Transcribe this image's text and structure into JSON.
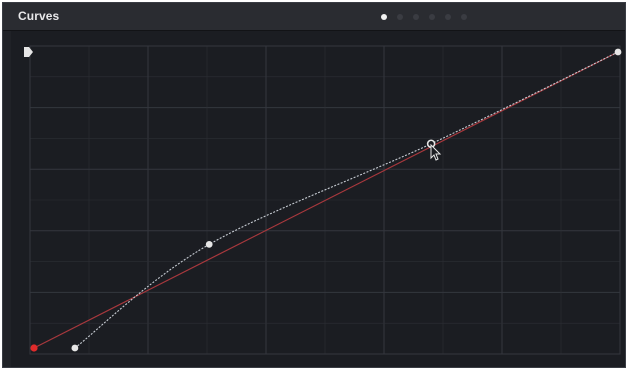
{
  "panel": {
    "title": "Curves",
    "pager": {
      "page_count": 6,
      "active_index": 0
    }
  },
  "curve": {
    "control_points": [
      {
        "input": 0.07,
        "output": 0.0,
        "role": "black-point"
      },
      {
        "input": 0.3,
        "output": 0.35
      },
      {
        "input": 0.68,
        "output": 0.69,
        "role": "selected"
      },
      {
        "input": 1.0,
        "output": 1.0,
        "role": "white-point"
      }
    ],
    "reference_line": {
      "from": [
        0.0,
        0.0
      ],
      "to": [
        1.0,
        1.0
      ]
    },
    "grid_divisions": 5,
    "colors": {
      "background": "#1b1d22",
      "header": "#2a2c31",
      "grid": "#2c2f35",
      "grid_major": "#34373e",
      "curve": "#c7ccd3",
      "reference_line": "#a8383d",
      "point": "#e6e6e6",
      "black_point": "#e02b2b"
    }
  }
}
